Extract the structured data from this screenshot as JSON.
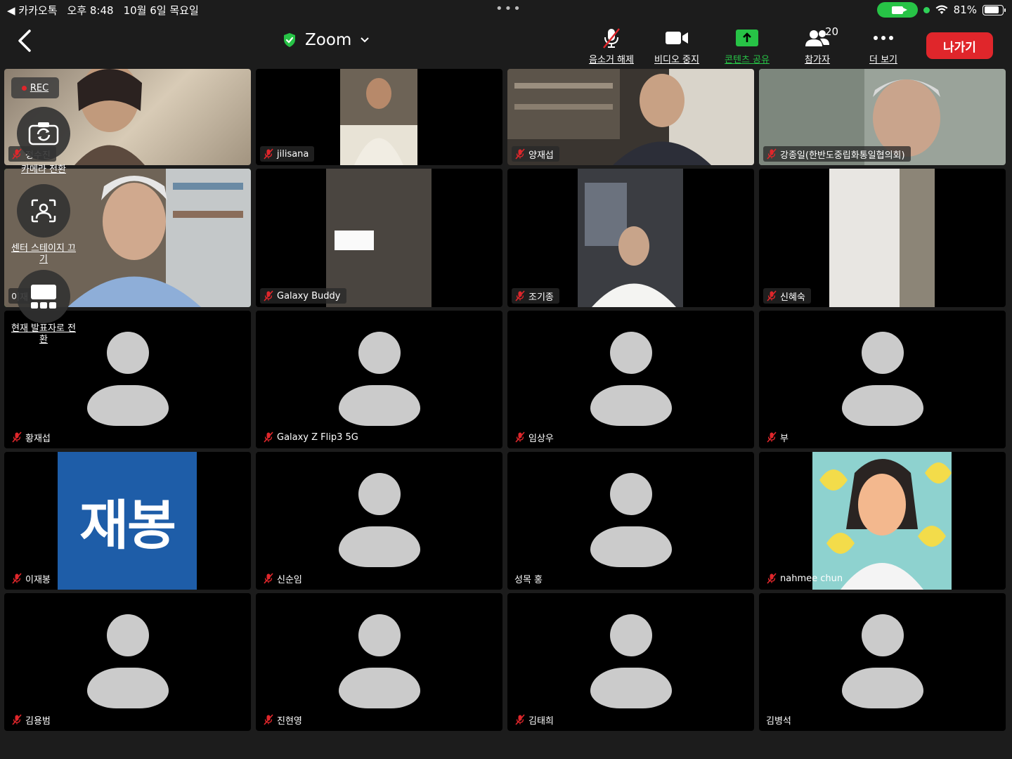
{
  "status_bar": {
    "back_app": "◀ 카카오톡",
    "time": "오후 8:48",
    "date": "10월 6일 목요일",
    "battery": "81%",
    "battery_level": 0.81
  },
  "meeting": {
    "title": "Zoom",
    "toolbar": {
      "mute": "음소거 해제",
      "video": "비디오 중지",
      "share": "콘텐츠 공유",
      "participants": "참가자",
      "participants_count": "20",
      "more": "더 보기",
      "leave": "나가기"
    },
    "overlay": {
      "rec": "REC",
      "switch_camera": "카메라 전환",
      "center_stage": "센터 스테이지 끄기",
      "switch_speaker": "현재 발표자로 전환"
    }
  },
  "participants": [
    {
      "name": "정수진",
      "muted": true,
      "video": true
    },
    {
      "name": "jilisana",
      "muted": true,
      "video": true
    },
    {
      "name": "양재섭",
      "muted": true,
      "video": true
    },
    {
      "name": "강종일(한반도중립화통일협의회)",
      "muted": true,
      "video": true
    },
    {
      "name": "이재",
      "muted": false,
      "video": true,
      "active": true
    },
    {
      "name": "Galaxy Buddy",
      "muted": true,
      "video": true
    },
    {
      "name": "조기종",
      "muted": true,
      "video": true
    },
    {
      "name": "신혜숙",
      "muted": true,
      "video": true
    },
    {
      "name": "황재섭",
      "muted": true,
      "video": false
    },
    {
      "name": "Galaxy Z Flip3 5G",
      "muted": true,
      "video": false
    },
    {
      "name": "임상우",
      "muted": true,
      "video": false
    },
    {
      "name": "부",
      "muted": true,
      "video": false
    },
    {
      "name": "이재봉",
      "muted": true,
      "video": false,
      "image_text": "재봉"
    },
    {
      "name": "신순임",
      "muted": true,
      "video": false
    },
    {
      "name": "성목 홍",
      "muted": false,
      "video": false
    },
    {
      "name": "nahmee chun",
      "muted": true,
      "video": false
    },
    {
      "name": "김용범",
      "muted": true,
      "video": false
    },
    {
      "name": "진현영",
      "muted": true,
      "video": false
    },
    {
      "name": "김태희",
      "muted": true,
      "video": false
    },
    {
      "name": "김병석",
      "muted": false,
      "video": false
    }
  ],
  "colors": {
    "accent_green": "#27c346",
    "leave_red": "#e0262b",
    "mute_red": "#e0262b",
    "avatar_gray": "#cbcbcb"
  }
}
